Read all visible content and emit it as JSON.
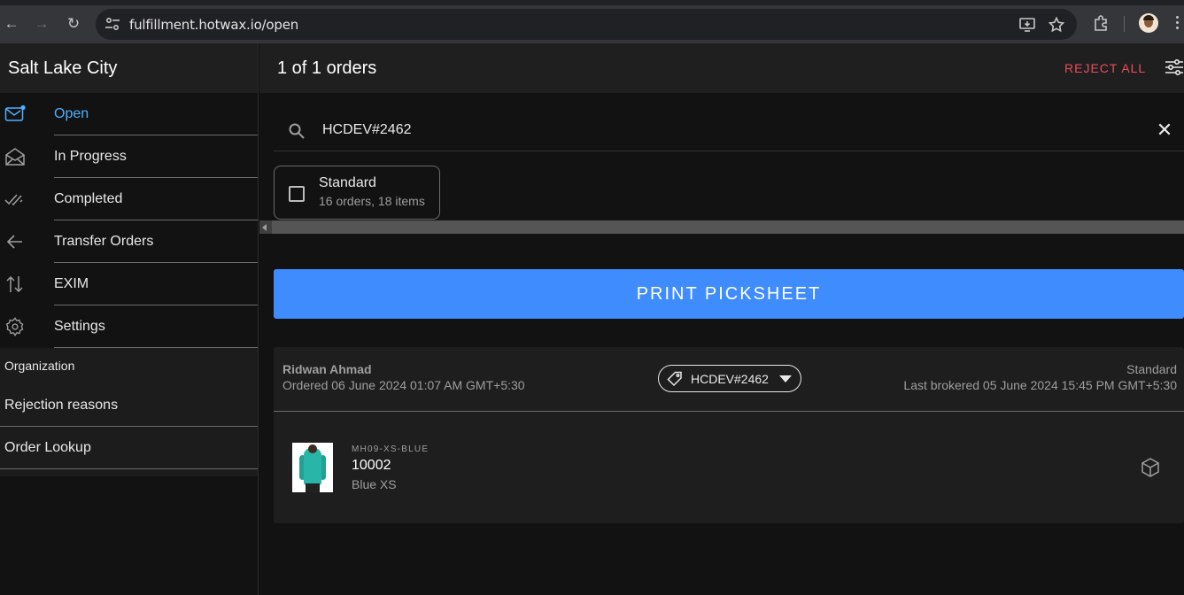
{
  "browser": {
    "url": "fulfillment.hotwax.io/open"
  },
  "sidebar": {
    "title": "Salt Lake City",
    "items": [
      {
        "label": "Open",
        "icon": "mail-unread-icon",
        "active": true
      },
      {
        "label": "In Progress",
        "icon": "mail-open-icon",
        "active": false
      },
      {
        "label": "Completed",
        "icon": "done-all-icon",
        "active": false
      },
      {
        "label": "Transfer Orders",
        "icon": "arrow-back-icon",
        "active": false
      },
      {
        "label": "EXIM",
        "icon": "swap-vertical-icon",
        "active": false
      },
      {
        "label": "Settings",
        "icon": "settings-icon",
        "active": false
      }
    ],
    "org_header": "Organization",
    "org_items": [
      {
        "label": "Rejection reasons"
      },
      {
        "label": "Order Lookup"
      }
    ]
  },
  "header": {
    "title": "1 of 1 orders",
    "reject_all": "REJECT ALL"
  },
  "search": {
    "value": "HCDEV#2462"
  },
  "shipment_method": {
    "title": "Standard",
    "subtitle": "16 orders, 18 items",
    "checked": false
  },
  "print_button": "PRINT PICKSHEET",
  "order": {
    "customer": "Ridwan Ahmad",
    "ordered": "Ordered 06 June 2024 01:07 AM GMT+5:30",
    "order_name": "HCDEV#2462",
    "shipping_method": "Standard",
    "last_brokered": "Last brokered 05 June 2024 15:45 PM GMT+5:30",
    "items": [
      {
        "sku": "MH09-XS-BLUE",
        "name": "10002",
        "variant": "Blue XS"
      }
    ]
  },
  "colors": {
    "accent": "#3f8cff",
    "active_nav": "#4fb0ff",
    "danger": "#e94e5b"
  }
}
